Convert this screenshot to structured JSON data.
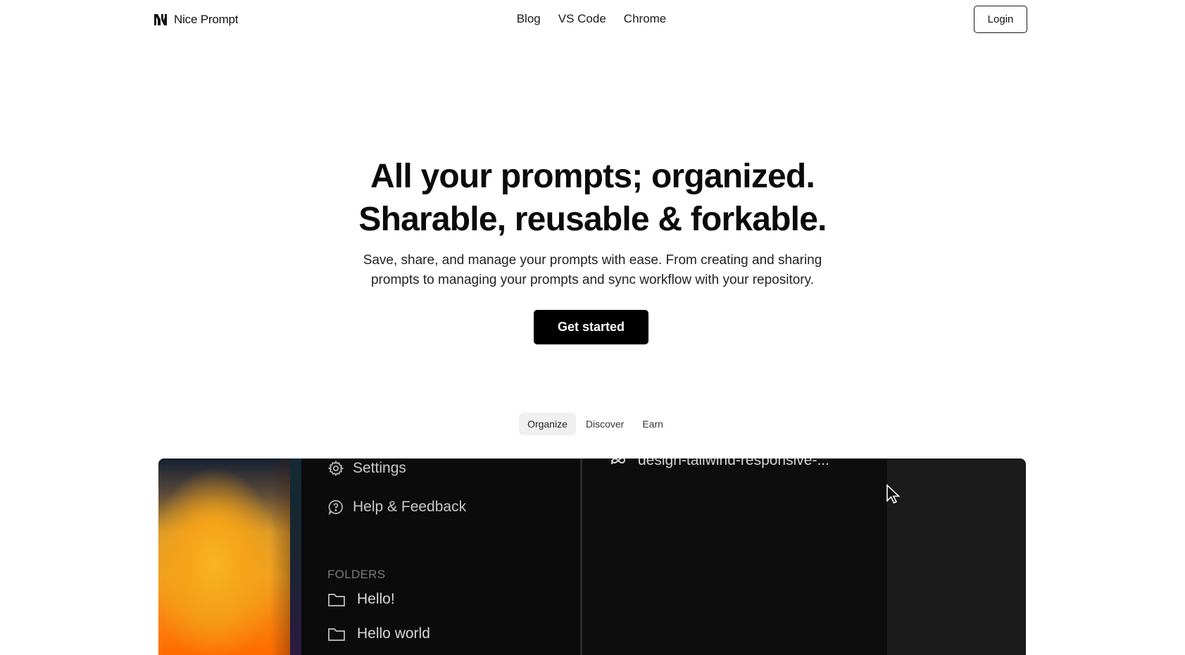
{
  "nav": {
    "brand": "Nice Prompt",
    "links": [
      "Blog",
      "VS Code",
      "Chrome"
    ],
    "login_label": "Login"
  },
  "hero": {
    "title_line1": "All your prompts; organized.",
    "title_line2": "Sharable, reusable & forkable.",
    "subtitle_line1": "Save, share, and manage your prompts with ease. From creating and sharing",
    "subtitle_line2": "prompts to managing your prompts and sync workflow with your repository.",
    "cta_label": "Get started"
  },
  "tabs": {
    "items": [
      "Organize",
      "Discover",
      "Earn"
    ],
    "active": "Organize"
  },
  "demo": {
    "sidebar": {
      "settings_label": "Settings",
      "help_label": "Help & Feedback",
      "folders_heading": "FOLDERS",
      "folders": [
        "Hello!",
        "Hello world"
      ]
    },
    "panel": {
      "item_label": "design-tailwind-responsive-..."
    }
  },
  "colors": {
    "cta_background": "#000000",
    "demo_background": "#1b1b1c",
    "sidebar_background": "#0b0b0c",
    "gradient_accent": "#f6b621"
  }
}
